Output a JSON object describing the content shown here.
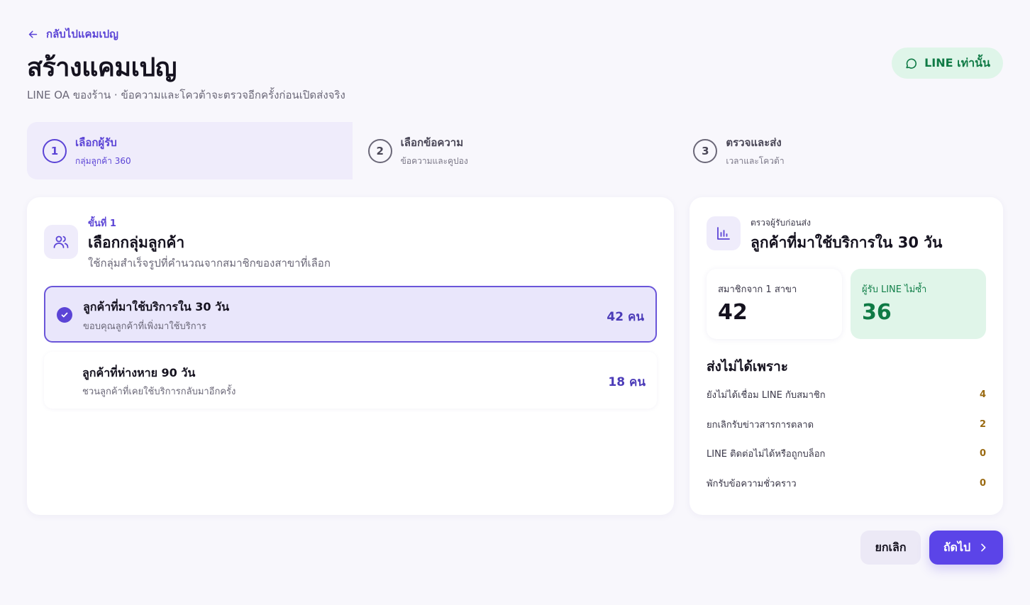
{
  "header": {
    "back_label": "กลับไปแคมเปญ",
    "title": "สร้างแคมเปญ",
    "subtitle": "LINE OA ของร้าน · ข้อความและโควต้าจะตรวจอีกครั้งก่อนเปิดส่งจริง",
    "channel_badge": "LINE เท่านั้น"
  },
  "steps": [
    {
      "number": "1",
      "title": "เลือกผู้รับ",
      "desc": "กลุ่มลูกค้า 360",
      "active": true
    },
    {
      "number": "2",
      "title": "เลือกข้อความ",
      "desc": "ข้อความและคูปอง",
      "active": false
    },
    {
      "number": "3",
      "title": "ตรวจและส่ง",
      "desc": "เวลาและโควต้า",
      "active": false
    }
  ],
  "audience": {
    "step_label": "ขั้นที่ 1",
    "title": "เลือกกลุ่มลูกค้า",
    "desc": "ใช้กลุ่มสำเร็จรูปที่คำนวณจากสมาชิกของสาขาที่เลือก",
    "options": [
      {
        "title": "ลูกค้าที่มาใช้บริการใน 30 วัน",
        "desc": "ขอบคุณลูกค้าที่เพิ่งมาใช้บริการ",
        "count": "42 คน",
        "selected": true
      },
      {
        "title": "ลูกค้าที่ห่างหาย 90 วัน",
        "desc": "ชวนลูกค้าที่เคยใช้บริการกลับมาอีกครั้ง",
        "count": "18 คน",
        "selected": false
      }
    ]
  },
  "summary": {
    "label": "ตรวจผู้รับก่อนส่ง",
    "title": "ลูกค้าที่มาใช้บริการใน 30 วัน",
    "members_label": "สมาชิกจาก 1 สาขา",
    "members_value": "42",
    "recipients_label": "ผู้รับ LINE ไม่ซ้ำ",
    "recipients_value": "36",
    "reasons_title": "ส่งไม่ได้เพราะ",
    "reasons": [
      {
        "label": "ยังไม่ได้เชื่อม LINE กับสมาชิก",
        "count": "4"
      },
      {
        "label": "ยกเลิกรับข่าวสารการตลาด",
        "count": "2"
      },
      {
        "label": "LINE ติดต่อไม่ได้หรือถูกบล็อก",
        "count": "0"
      },
      {
        "label": "พักรับข้อความชั่วคราว",
        "count": "0"
      }
    ]
  },
  "actions": {
    "cancel_label": "ยกเลิก",
    "next_label": "ถัดไป"
  },
  "colors": {
    "accent": "#5b44e8",
    "line_green": "#0f7a45",
    "warning": "#9a6a12"
  }
}
